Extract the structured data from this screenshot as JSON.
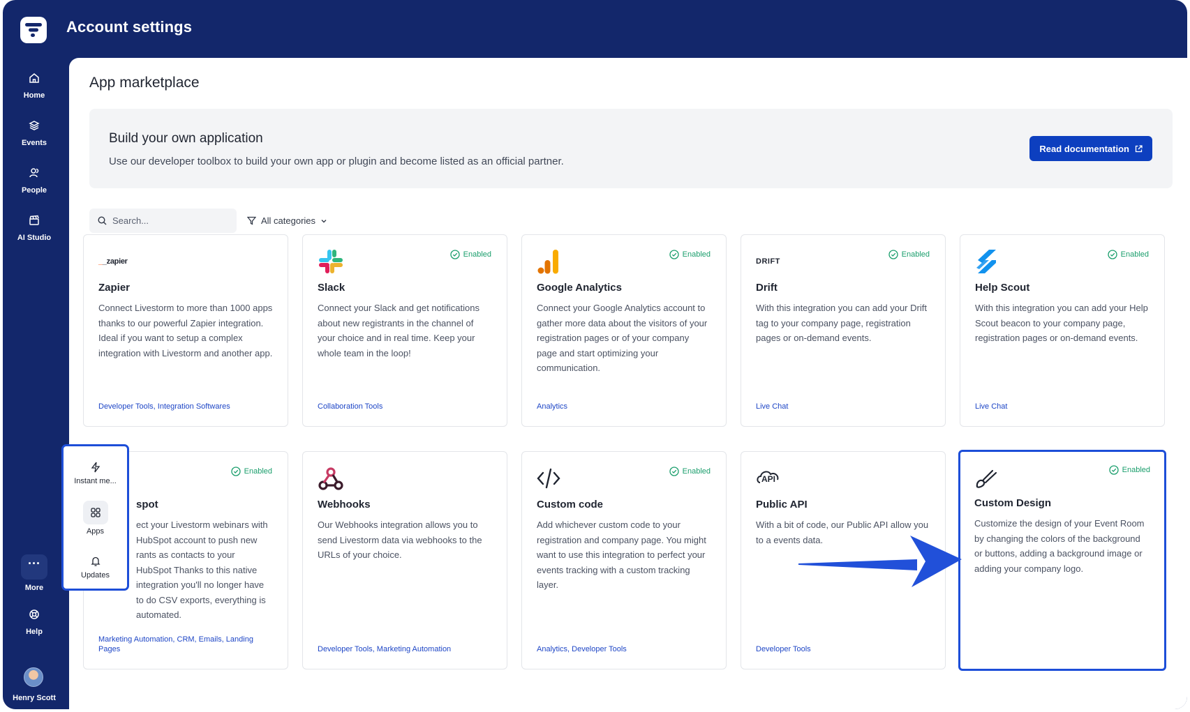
{
  "app": {
    "title": "Account settings"
  },
  "sidebar": {
    "items": [
      {
        "label": "Home",
        "icon": "home-icon"
      },
      {
        "label": "Events",
        "icon": "layers-icon"
      },
      {
        "label": "People",
        "icon": "people-icon"
      },
      {
        "label": "AI Studio",
        "icon": "clapper-icon"
      }
    ],
    "more_label": "More",
    "help_label": "Help",
    "user_name": "Henry Scott"
  },
  "popover": {
    "items": [
      {
        "label": "Instant me...",
        "icon": "bolt-icon"
      },
      {
        "label": "Apps",
        "icon": "grid-icon",
        "active": true
      },
      {
        "label": "Updates",
        "icon": "bell-icon"
      }
    ]
  },
  "main": {
    "page_title": "App marketplace",
    "banner": {
      "title": "Build your own application",
      "description": "Use our developer toolbox to build your own app or plugin and become listed as an official partner.",
      "button_label": "Read documentation"
    },
    "search": {
      "placeholder": "Search...",
      "value": ""
    },
    "filter": {
      "label": "All categories"
    },
    "enabled_label": "Enabled",
    "cards": [
      {
        "name": "Zapier",
        "logo_text": "_zapier",
        "enabled": false,
        "description": "Connect Livestorm to more than 1000 apps thanks to our powerful Zapier integration. Ideal if you want to setup a complex integration with Livestorm and another app.",
        "tags": "Developer Tools, Integration Softwares"
      },
      {
        "name": "Slack",
        "enabled": true,
        "description": "Connect your Slack and get notifications about new registrants in the channel of your choice and in real time. Keep your whole team in the loop!",
        "tags": "Collaboration Tools"
      },
      {
        "name": "Google Analytics",
        "enabled": true,
        "description": "Connect your Google Analytics account to gather more data about the visitors of your registration pages or of your company page and start optimizing your communication.",
        "tags": "Analytics"
      },
      {
        "name": "Drift",
        "logo_text": "DRIFT",
        "enabled": true,
        "description": "With this integration you can add your Drift tag to your company page, registration pages or on-demand events.",
        "tags": "Live Chat"
      },
      {
        "name": "Help Scout",
        "enabled": true,
        "description": "With this integration you can add your Help Scout beacon to your company page, registration pages or on-demand events.",
        "tags": "Live Chat"
      },
      {
        "name": "spot",
        "enabled": true,
        "description": "ect your Livestorm webinars with HubSpot account to push new rants as contacts to your HubSpot Thanks to this native integration you'll no longer have to do CSV exports, everything is automated.",
        "tags": "Marketing Automation, CRM, Emails, Landing Pages"
      },
      {
        "name": "Webhooks",
        "enabled": false,
        "description": "Our Webhooks integration allows you to send Livestorm data via webhooks to the URLs of your choice.",
        "tags": "Developer Tools, Marketing Automation"
      },
      {
        "name": "Custom code",
        "enabled": true,
        "description": "Add whichever custom code to your registration and company page. You might want to use this integration to perfect your events tracking with a custom tracking layer.",
        "tags": "Analytics, Developer Tools"
      },
      {
        "name": "Public API",
        "logo_text": "API",
        "enabled": false,
        "description": "With a bit of code, our Public API allow you to a                      events data.",
        "tags": "Developer Tools"
      },
      {
        "name": "Custom Design",
        "enabled": true,
        "description": "Customize the design of your Event Room by changing the colors of the background or buttons, adding a background image or adding your company logo.",
        "tags": ""
      }
    ]
  },
  "colors": {
    "nav_bg": "#13276b",
    "accent": "#1d4ed8",
    "enabled_green": "#1a9e6c",
    "tag_blue": "#1e46c6"
  }
}
